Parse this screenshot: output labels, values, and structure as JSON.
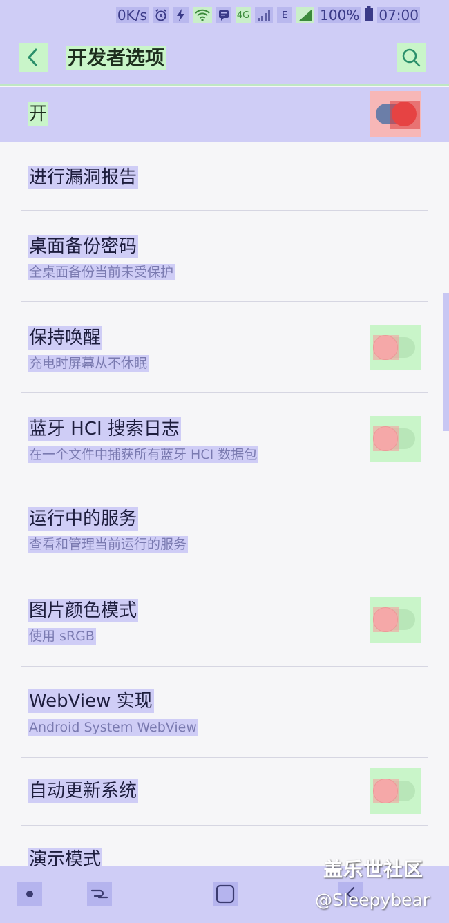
{
  "status_bar": {
    "speed": "0K/s",
    "network": "4G",
    "network_e": "E",
    "battery": "100%",
    "time": "07:00",
    "icons": [
      "alarm-icon",
      "flash-icon",
      "wifi-icon",
      "message-icon",
      "signal-icon",
      "signal-icon",
      "battery-icon"
    ]
  },
  "app_bar": {
    "title": "开发者选项",
    "back_icon": "back-arrow-icon",
    "search_icon": "search-icon"
  },
  "master": {
    "label": "开",
    "enabled": true
  },
  "settings": [
    {
      "title": "进行漏洞报告",
      "subtitle": "",
      "toggle": null
    },
    {
      "title": "桌面备份密码",
      "subtitle": "全桌面备份当前未受保护",
      "toggle": null
    },
    {
      "title": "保持唤醒",
      "subtitle": "充电时屏幕从不休眠",
      "toggle": false
    },
    {
      "title": "蓝牙 HCI 搜索日志",
      "subtitle": "在一个文件中捕获所有蓝牙 HCI 数据包",
      "toggle": false
    },
    {
      "title": "运行中的服务",
      "subtitle": "查看和管理当前运行的服务",
      "toggle": null
    },
    {
      "title": "图片颜色模式",
      "subtitle": "使用 sRGB",
      "toggle": false
    },
    {
      "title": "WebView 实现",
      "subtitle": "Android System WebView",
      "toggle": null
    },
    {
      "title": "自动更新系统",
      "subtitle": "",
      "toggle": false
    },
    {
      "title": "演示模式",
      "subtitle": "",
      "toggle": null
    }
  ],
  "nav_bar": {
    "recent_icon": "recents-icon",
    "home_icon": "home-icon",
    "back_icon": "nav-back-icon",
    "dot_icon": "dot-icon"
  },
  "watermark": {
    "line1": "盖乐世社区",
    "line2": "@Sleepybear"
  }
}
